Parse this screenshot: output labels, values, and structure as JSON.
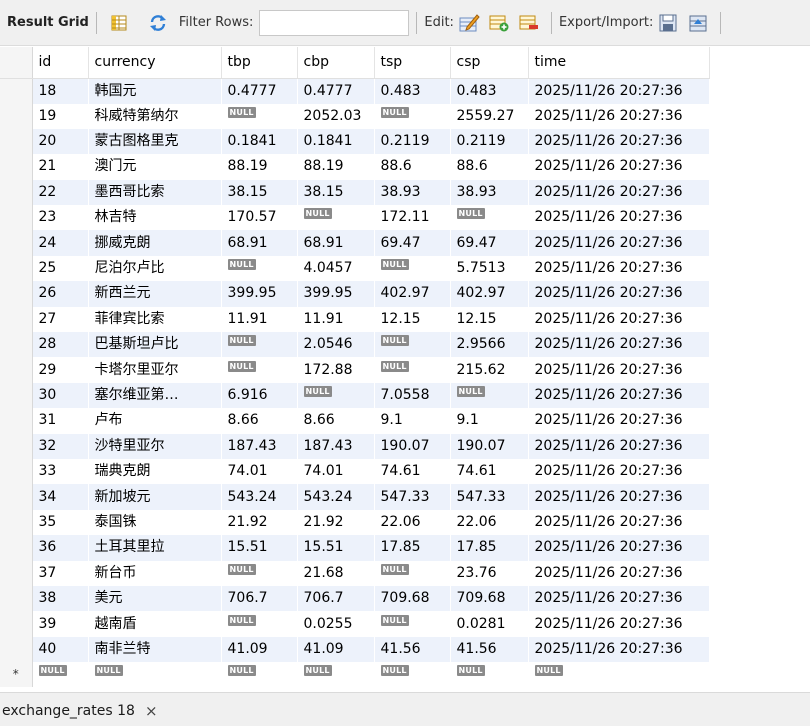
{
  "toolbar": {
    "result_grid_label": "Result Grid",
    "filter_rows_label": "Filter Rows:",
    "filter_value": "",
    "edit_label": "Edit:",
    "export_import_label": "Export/Import:"
  },
  "grid": {
    "columns": [
      "id",
      "currency",
      "tbp",
      "cbp",
      "tsp",
      "csp",
      "time"
    ],
    "rows": [
      [
        "18",
        "韩国元",
        "0.4777",
        "0.4777",
        "0.483",
        "0.483",
        "2025/11/26 20:27:36"
      ],
      [
        "19",
        "科威特第纳尔",
        null,
        "2052.03",
        null,
        "2559.27",
        "2025/11/26 20:27:36"
      ],
      [
        "20",
        "蒙古图格里克",
        "0.1841",
        "0.1841",
        "0.2119",
        "0.2119",
        "2025/11/26 20:27:36"
      ],
      [
        "21",
        "澳门元",
        "88.19",
        "88.19",
        "88.6",
        "88.6",
        "2025/11/26 20:27:36"
      ],
      [
        "22",
        "墨西哥比索",
        "38.15",
        "38.15",
        "38.93",
        "38.93",
        "2025/11/26 20:27:36"
      ],
      [
        "23",
        "林吉特",
        "170.57",
        null,
        "172.11",
        null,
        "2025/11/26 20:27:36"
      ],
      [
        "24",
        "挪威克朗",
        "68.91",
        "68.91",
        "69.47",
        "69.47",
        "2025/11/26 20:27:36"
      ],
      [
        "25",
        "尼泊尔卢比",
        null,
        "4.0457",
        null,
        "5.7513",
        "2025/11/26 20:27:36"
      ],
      [
        "26",
        "新西兰元",
        "399.95",
        "399.95",
        "402.97",
        "402.97",
        "2025/11/26 20:27:36"
      ],
      [
        "27",
        "菲律宾比索",
        "11.91",
        "11.91",
        "12.15",
        "12.15",
        "2025/11/26 20:27:36"
      ],
      [
        "28",
        "巴基斯坦卢比",
        null,
        "2.0546",
        null,
        "2.9566",
        "2025/11/26 20:27:36"
      ],
      [
        "29",
        "卡塔尔里亚尔",
        null,
        "172.88",
        null,
        "215.62",
        "2025/11/26 20:27:36"
      ],
      [
        "30",
        "塞尔维亚第…",
        "6.916",
        null,
        "7.0558",
        null,
        "2025/11/26 20:27:36"
      ],
      [
        "31",
        "卢布",
        "8.66",
        "8.66",
        "9.1",
        "9.1",
        "2025/11/26 20:27:36"
      ],
      [
        "32",
        "沙特里亚尔",
        "187.43",
        "187.43",
        "190.07",
        "190.07",
        "2025/11/26 20:27:36"
      ],
      [
        "33",
        "瑞典克朗",
        "74.01",
        "74.01",
        "74.61",
        "74.61",
        "2025/11/26 20:27:36"
      ],
      [
        "34",
        "新加坡元",
        "543.24",
        "543.24",
        "547.33",
        "547.33",
        "2025/11/26 20:27:36"
      ],
      [
        "35",
        "泰国铢",
        "21.92",
        "21.92",
        "22.06",
        "22.06",
        "2025/11/26 20:27:36"
      ],
      [
        "36",
        "土耳其里拉",
        "15.51",
        "15.51",
        "17.85",
        "17.85",
        "2025/11/26 20:27:36"
      ],
      [
        "37",
        "新台币",
        null,
        "21.68",
        null,
        "23.76",
        "2025/11/26 20:27:36"
      ],
      [
        "38",
        "美元",
        "706.7",
        "706.7",
        "709.68",
        "709.68",
        "2025/11/26 20:27:36"
      ],
      [
        "39",
        "越南盾",
        null,
        "0.0255",
        null,
        "0.0281",
        "2025/11/26 20:27:36"
      ],
      [
        "40",
        "南非兰特",
        "41.09",
        "41.09",
        "41.56",
        "41.56",
        "2025/11/26 20:27:36"
      ]
    ],
    "null_label": "NULL",
    "new_row_marker": "*"
  },
  "tab": {
    "label": "exchange_rates 18",
    "close_glyph": "×"
  }
}
